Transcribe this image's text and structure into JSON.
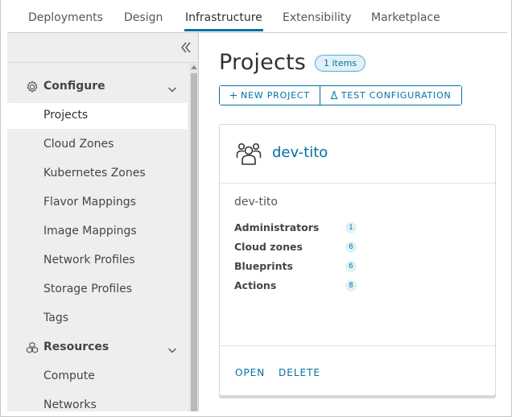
{
  "tabs": [
    {
      "label": "Deployments",
      "active": false
    },
    {
      "label": "Design",
      "active": false
    },
    {
      "label": "Infrastructure",
      "active": true
    },
    {
      "label": "Extensibility",
      "active": false
    },
    {
      "label": "Marketplace",
      "active": false
    }
  ],
  "sidebar": {
    "collapse_icon": "double-chevron-left-icon",
    "groups": [
      {
        "label": "Configure",
        "icon": "gear-icon",
        "expanded": true
      },
      {
        "label": "Resources",
        "icon": "cubes-icon",
        "expanded": true
      }
    ],
    "configure_items": [
      {
        "label": "Projects",
        "active": true
      },
      {
        "label": "Cloud Zones",
        "active": false
      },
      {
        "label": "Kubernetes Zones",
        "active": false
      },
      {
        "label": "Flavor Mappings",
        "active": false
      },
      {
        "label": "Image Mappings",
        "active": false
      },
      {
        "label": "Network Profiles",
        "active": false
      },
      {
        "label": "Storage Profiles",
        "active": false
      },
      {
        "label": "Tags",
        "active": false
      }
    ],
    "resources_items": [
      {
        "label": "Compute",
        "active": false
      },
      {
        "label": "Networks",
        "active": false
      }
    ]
  },
  "main": {
    "title": "Projects",
    "count_badge": "1 items",
    "new_project_label": "NEW PROJECT",
    "test_config_label": "TEST CONFIGURATION"
  },
  "project_card": {
    "icon": "users-group-icon",
    "title": "dev-tito",
    "subtitle": "dev-tito",
    "properties": [
      {
        "label": "Administrators",
        "count": "1"
      },
      {
        "label": "Cloud zones",
        "count": "6"
      },
      {
        "label": "Blueprints",
        "count": "6"
      },
      {
        "label": "Actions",
        "count": "8"
      }
    ],
    "open_label": "OPEN",
    "delete_label": "DELETE"
  },
  "colors": {
    "accent": "#0072a3",
    "badge_bg": "#e1f1f6",
    "sidebar_bg": "#eeeeee",
    "text": "#313131"
  }
}
